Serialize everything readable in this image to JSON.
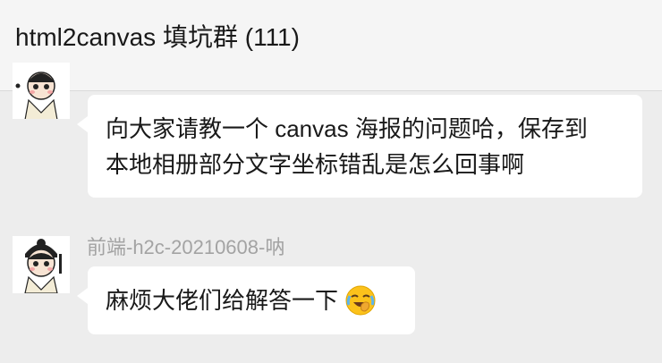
{
  "header": {
    "title": "html2canvas 填坑群 (111)"
  },
  "messages": [
    {
      "sender": "",
      "lines": [
        "向大家请教一个 canvas 海报的问题哈，保存到",
        "本地相册部分文字坐标错乱是怎么回事啊"
      ]
    },
    {
      "sender": "前端-h2c-20210608-呐",
      "text": "麻烦大佬们给解答一下",
      "emoji": "face-with-tears-of-joy-icon"
    }
  ],
  "colors": {
    "background": "#ededed",
    "header_bg": "#f5f5f5",
    "bubble_bg": "#ffffff",
    "sender_name": "#a3a3a3"
  }
}
